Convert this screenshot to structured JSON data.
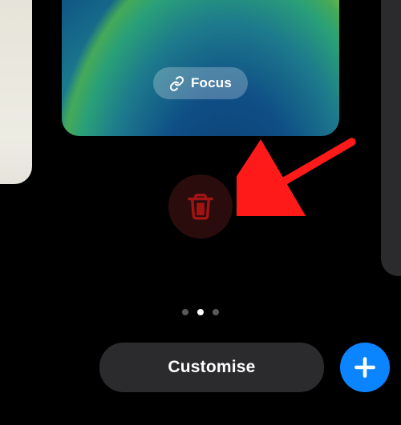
{
  "focus": {
    "label": "Focus"
  },
  "buttons": {
    "delete": "Delete",
    "customise": "Customise",
    "add": "Add"
  },
  "pager": {
    "count": 3,
    "active_index": 1
  },
  "colors": {
    "accent_blue": "#0a84ff",
    "delete_red": "#a01414",
    "arrow_red": "#ff1a1a"
  },
  "icons": {
    "link": "link-icon",
    "trash": "trash-icon",
    "plus": "plus-icon"
  }
}
